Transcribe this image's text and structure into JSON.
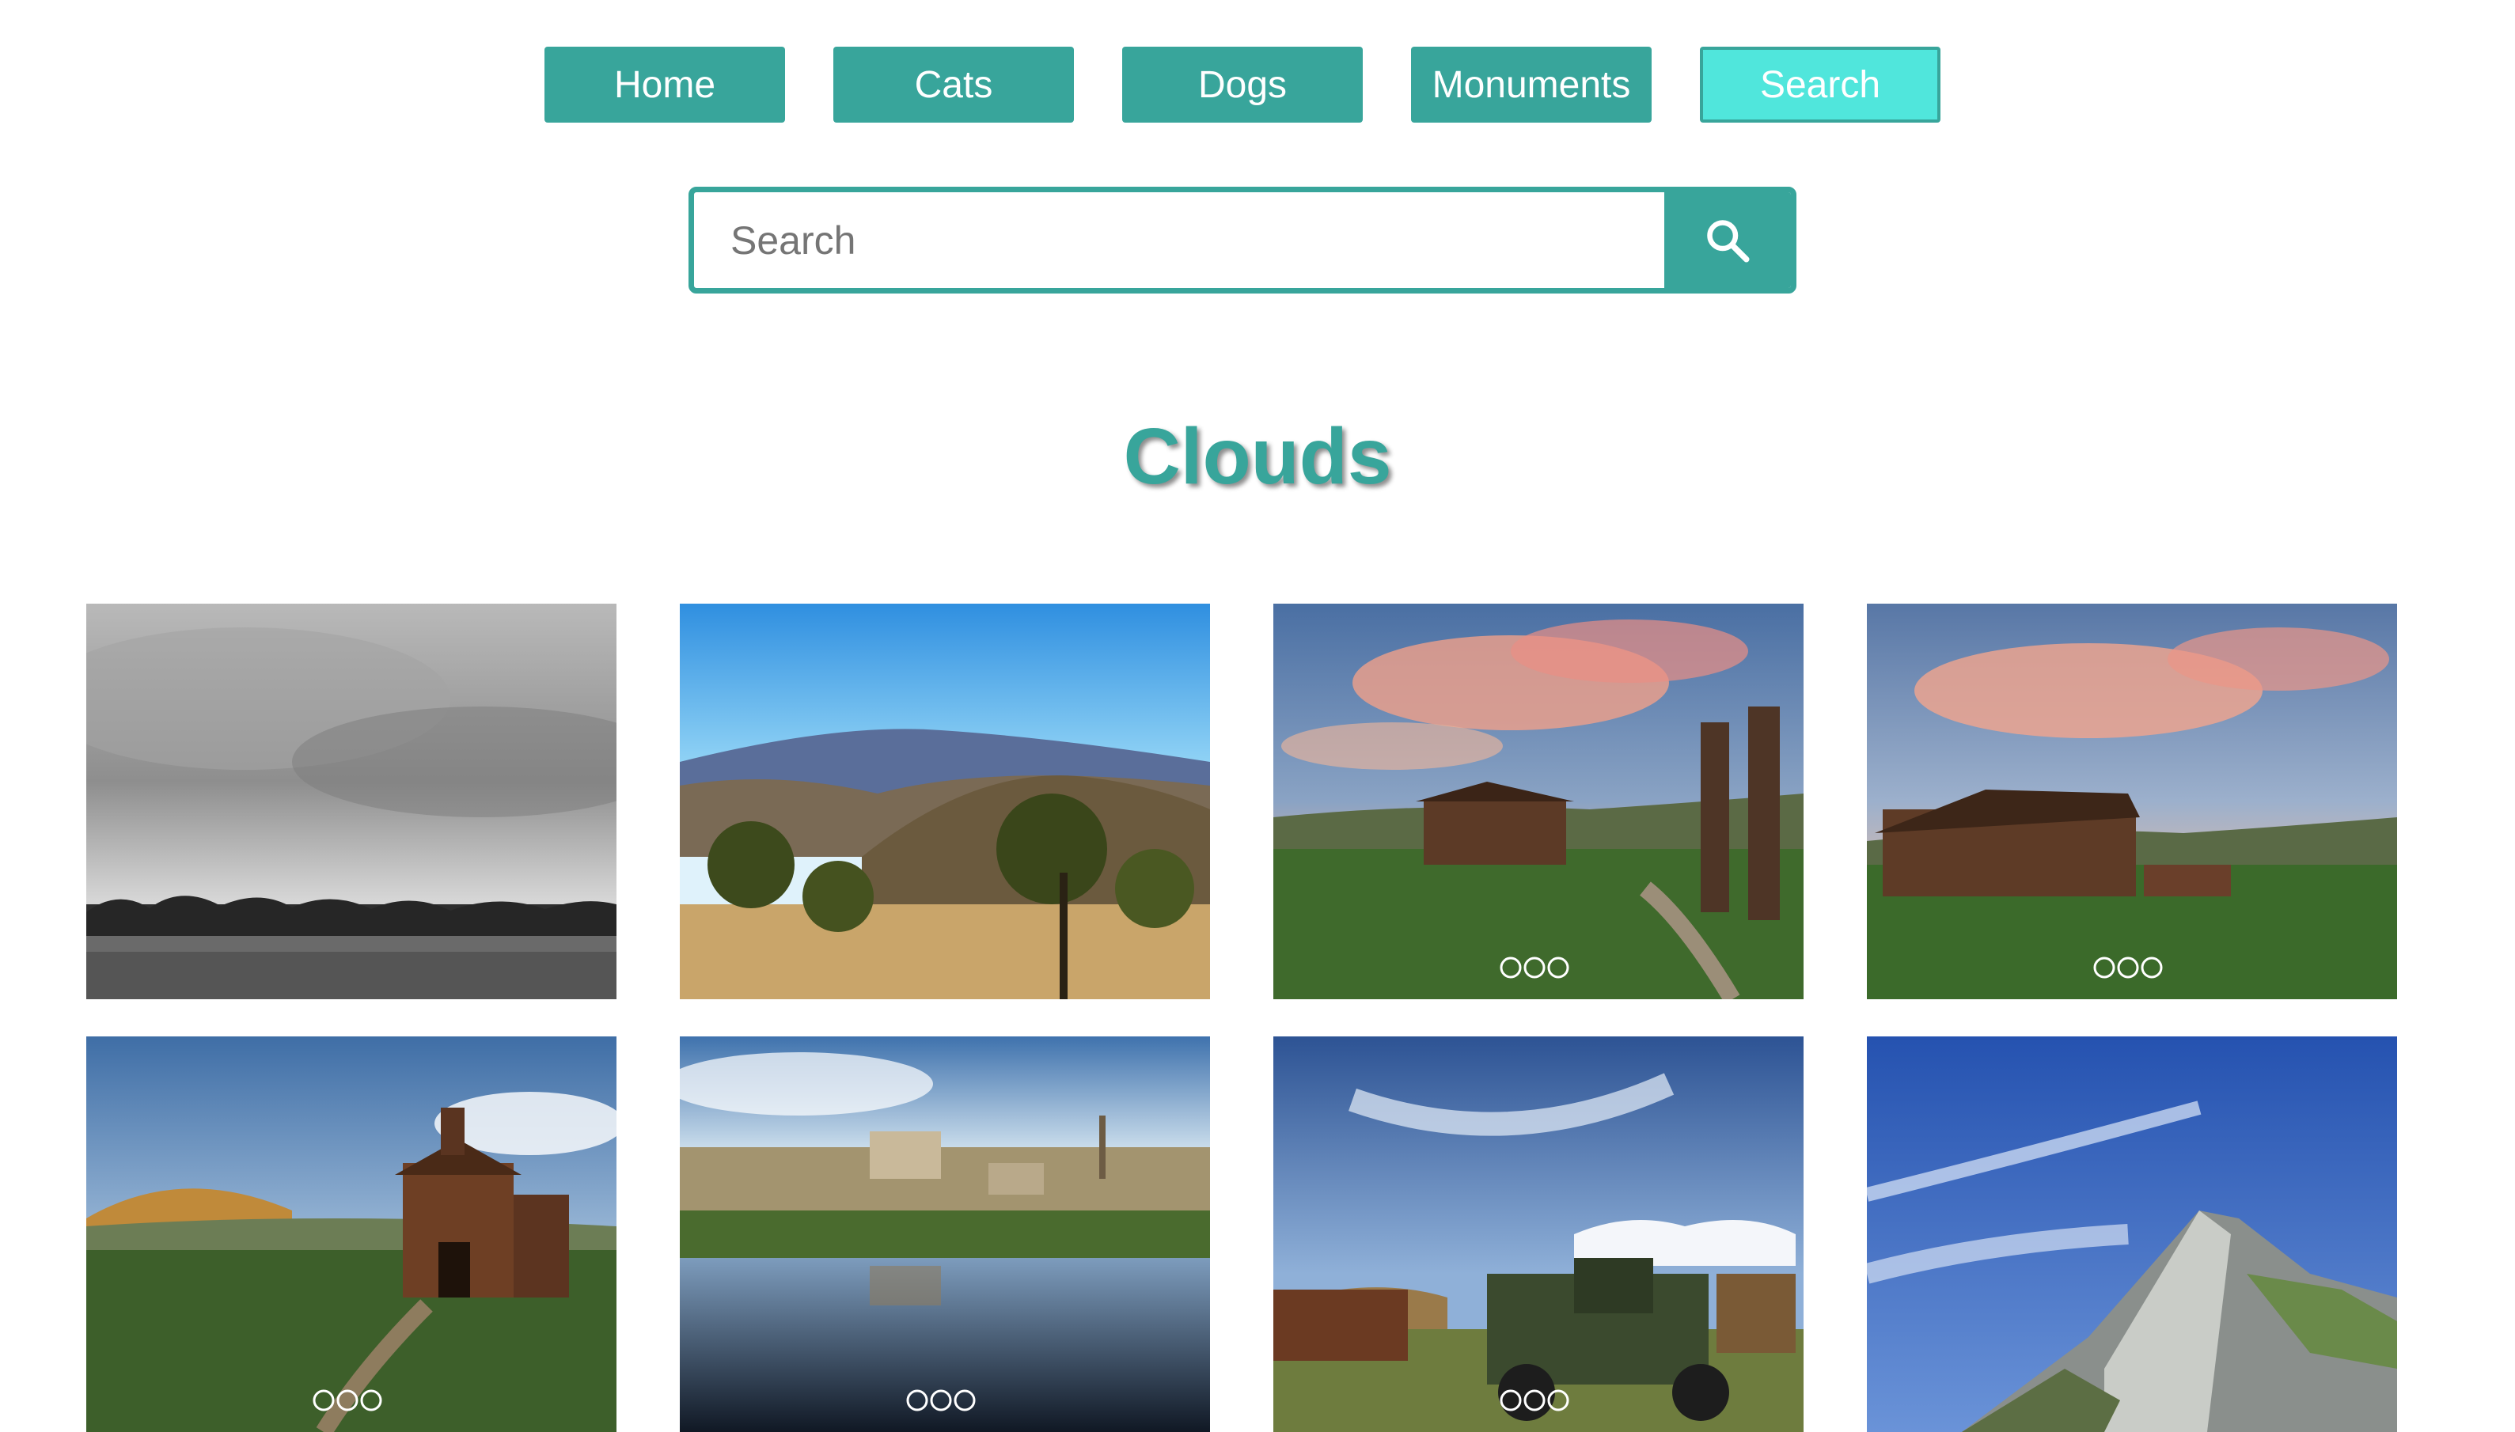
{
  "nav": {
    "items": [
      {
        "label": "Home",
        "active": false
      },
      {
        "label": "Cats",
        "active": false
      },
      {
        "label": "Dogs",
        "active": false
      },
      {
        "label": "Monuments",
        "active": false
      },
      {
        "label": "Search",
        "active": true
      }
    ]
  },
  "search": {
    "placeholder": "Search",
    "value": "",
    "button_icon": "search-icon"
  },
  "page": {
    "title": "Clouds"
  },
  "colors": {
    "accent": "#38a59b",
    "active": "#50e6dc",
    "text_on_accent": "#ffffff"
  },
  "gallery": {
    "images": [
      {
        "subject": "grayscale overcast sky over field"
      },
      {
        "subject": "blue sky over hills with oak trees"
      },
      {
        "subject": "sunset clouds over old cabins with gas pumps"
      },
      {
        "subject": "sunset clouds over wooden cabin"
      },
      {
        "subject": "old wooden church on grassy hill"
      },
      {
        "subject": "pond reflecting old mill buildings"
      },
      {
        "subject": "wispy clouds over rusty old truck"
      },
      {
        "subject": "rocky mountain peak under blue sky"
      }
    ]
  }
}
